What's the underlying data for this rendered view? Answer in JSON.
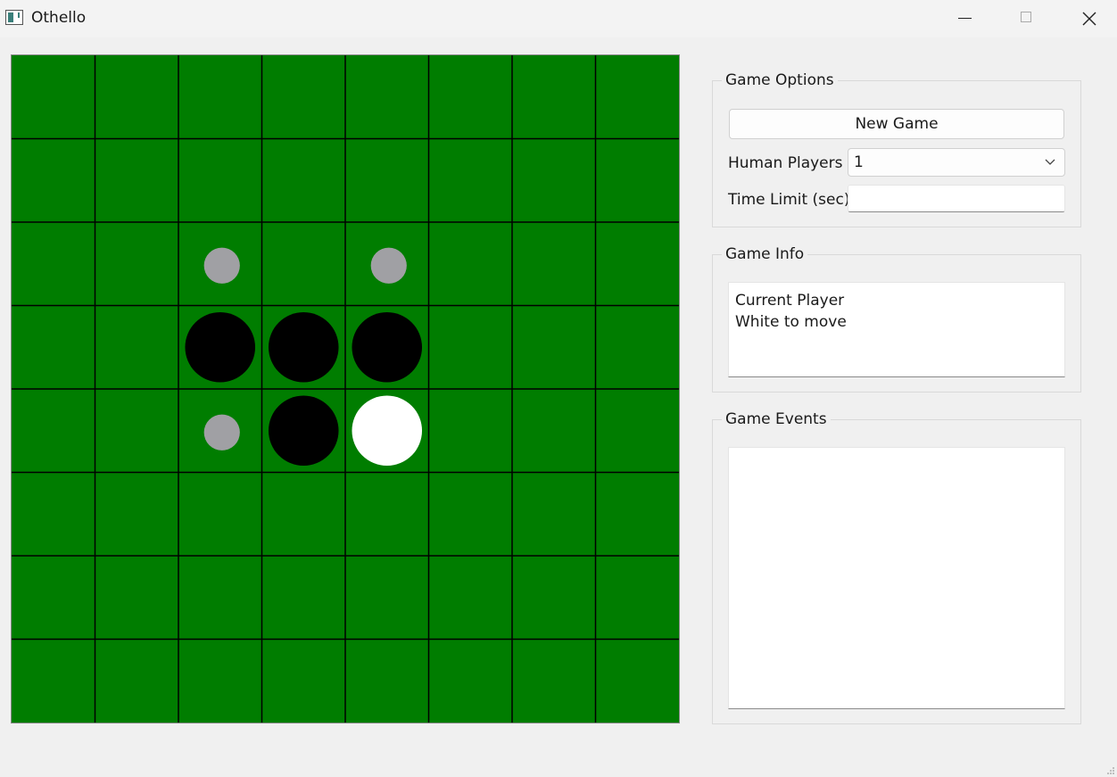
{
  "window": {
    "title": "Othello",
    "app_icon": "othello-app-icon"
  },
  "board": {
    "rows": 8,
    "cols": 8,
    "colors": {
      "background": "#007d00",
      "grid_line": "#000000",
      "black": "#000000",
      "white": "#ffffff",
      "hint": "#a0a0a4"
    },
    "pieces": [
      {
        "row": 3,
        "col": 2,
        "color": "black"
      },
      {
        "row": 3,
        "col": 3,
        "color": "black"
      },
      {
        "row": 3,
        "col": 4,
        "color": "black"
      },
      {
        "row": 4,
        "col": 3,
        "color": "black"
      },
      {
        "row": 4,
        "col": 4,
        "color": "white"
      }
    ],
    "hints": [
      {
        "row": 2,
        "col": 2
      },
      {
        "row": 2,
        "col": 4
      },
      {
        "row": 4,
        "col": 2
      }
    ]
  },
  "game_options": {
    "legend": "Game Options",
    "new_game_label": "New Game",
    "human_players_label": "Human Players",
    "human_players_value": "1",
    "time_limit_label": "Time Limit (sec)",
    "time_limit_value": ""
  },
  "game_info": {
    "legend": "Game Info",
    "line1": "Current Player",
    "line2": "White to move"
  },
  "game_events": {
    "legend": "Game Events",
    "log": ""
  }
}
